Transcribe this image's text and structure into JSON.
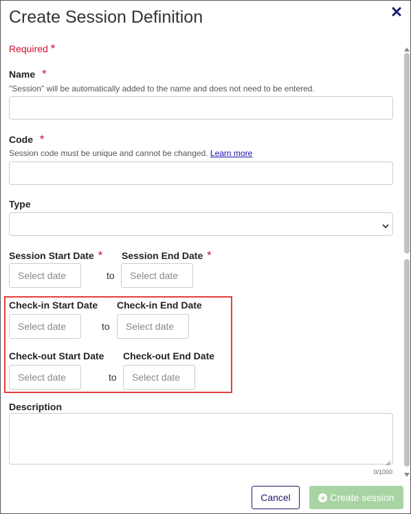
{
  "dialog": {
    "title": "Create Session Definition",
    "close_icon": "close-icon",
    "required_label": "Required"
  },
  "required_marker": "*",
  "fields": {
    "name": {
      "label": "Name",
      "hint": "\"Session\" will be automatically added to the name and does not need to be entered.",
      "value": ""
    },
    "code": {
      "label": "Code",
      "hint": "Session code must be unique and cannot be changed.",
      "learn_more": "Learn more",
      "value": ""
    },
    "type": {
      "label": "Type",
      "selected": ""
    },
    "session_start": {
      "label": "Session Start Date",
      "placeholder": "Select date"
    },
    "session_end": {
      "label": "Session End Date",
      "placeholder": "Select date"
    },
    "checkin_start": {
      "label": "Check-in Start Date",
      "placeholder": "Select date"
    },
    "checkin_end": {
      "label": "Check-in End Date",
      "placeholder": "Select date"
    },
    "checkout_start": {
      "label": "Check-out Start Date",
      "placeholder": "Select date"
    },
    "checkout_end": {
      "label": "Check-out End Date",
      "placeholder": "Select date"
    },
    "range_separator": "to",
    "description": {
      "label": "Description",
      "counter": "0/1000",
      "value": ""
    }
  },
  "footer": {
    "cancel_label": "Cancel",
    "create_label": "Create session"
  },
  "colors": {
    "required": "#c8102e",
    "highlight": "#e03e3e",
    "cancel_border": "#1e1a6b",
    "create_disabled": "#a8d4a3"
  }
}
